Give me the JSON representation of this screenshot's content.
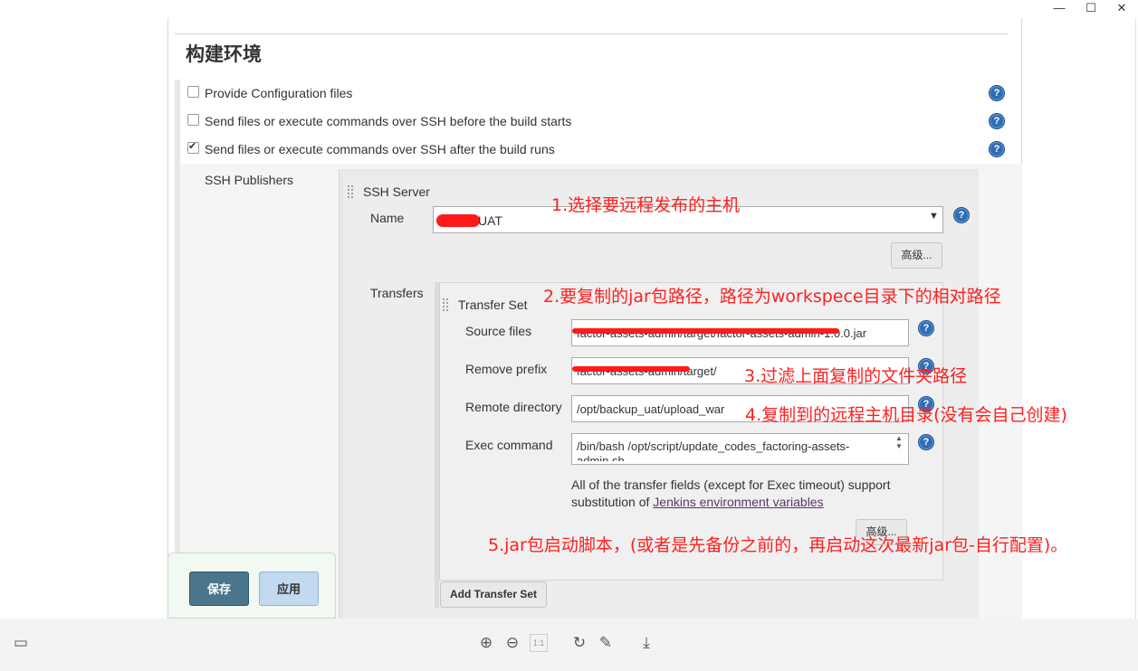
{
  "window": {
    "minimize": "—",
    "maximize": "☐",
    "close": "✕"
  },
  "section": {
    "title": "构建环境"
  },
  "options": [
    {
      "label": "Provide Configuration files",
      "checked": false
    },
    {
      "label": "Send files or execute commands over SSH before the build starts",
      "checked": false
    },
    {
      "label": "Send files or execute commands over SSH after the build runs",
      "checked": true
    }
  ],
  "ssh": {
    "publishers_label": "SSH Publishers",
    "server_label": "SSH Server",
    "name_label": "Name",
    "name_value": "UAT",
    "advanced_button": "高级...",
    "transfers_label": "Transfers",
    "transfer_set_label": "Transfer Set",
    "source_files_label": "Source files",
    "source_files_value": "factor-assets-admin/target/factor-assets-admin-1.0.0.jar",
    "remove_prefix_label": "Remove prefix",
    "remove_prefix_value": "factor-assets-admin/target/",
    "remote_dir_label": "Remote directory",
    "remote_dir_value": "/opt/backup_uat/upload_war",
    "exec_label": "Exec command",
    "exec_value": "/bin/bash /opt/script/update_codes_factoring-assets-admin.sh",
    "note_text": "All of the transfer fields (except for Exec timeout) support substitution of ",
    "note_link": "Jenkins environment variables",
    "advanced_button_2": "高级...",
    "add_transfer_set": "Add Transfer Set",
    "help_glyph": "?"
  },
  "footer": {
    "save": "保存",
    "apply": "应用"
  },
  "annotations": [
    "1.选择要远程发布的主机",
    "2.要复制的jar包路径，路径为workspece目录下的相对路径",
    "3.过滤上面复制的文件夹路径",
    "4.复制到的远程主机目录(没有会自己创建)",
    "5.jar包启动脚本，(或者是先备份之前的，再启动这次最新jar包-自行配置)。"
  ],
  "colors": {
    "annotation": "#ff1f1f",
    "save_button": "#4b758b",
    "apply_button": "#c3d9ef",
    "help_icon": "#2f6eb5"
  },
  "viewer_toolbar": {
    "panel_icon": "▭",
    "zoom_in": "⊕",
    "zoom_out": "⊖",
    "actual_size": "1:1",
    "rotate": "↻",
    "edit": "✎",
    "download": "⤓"
  }
}
